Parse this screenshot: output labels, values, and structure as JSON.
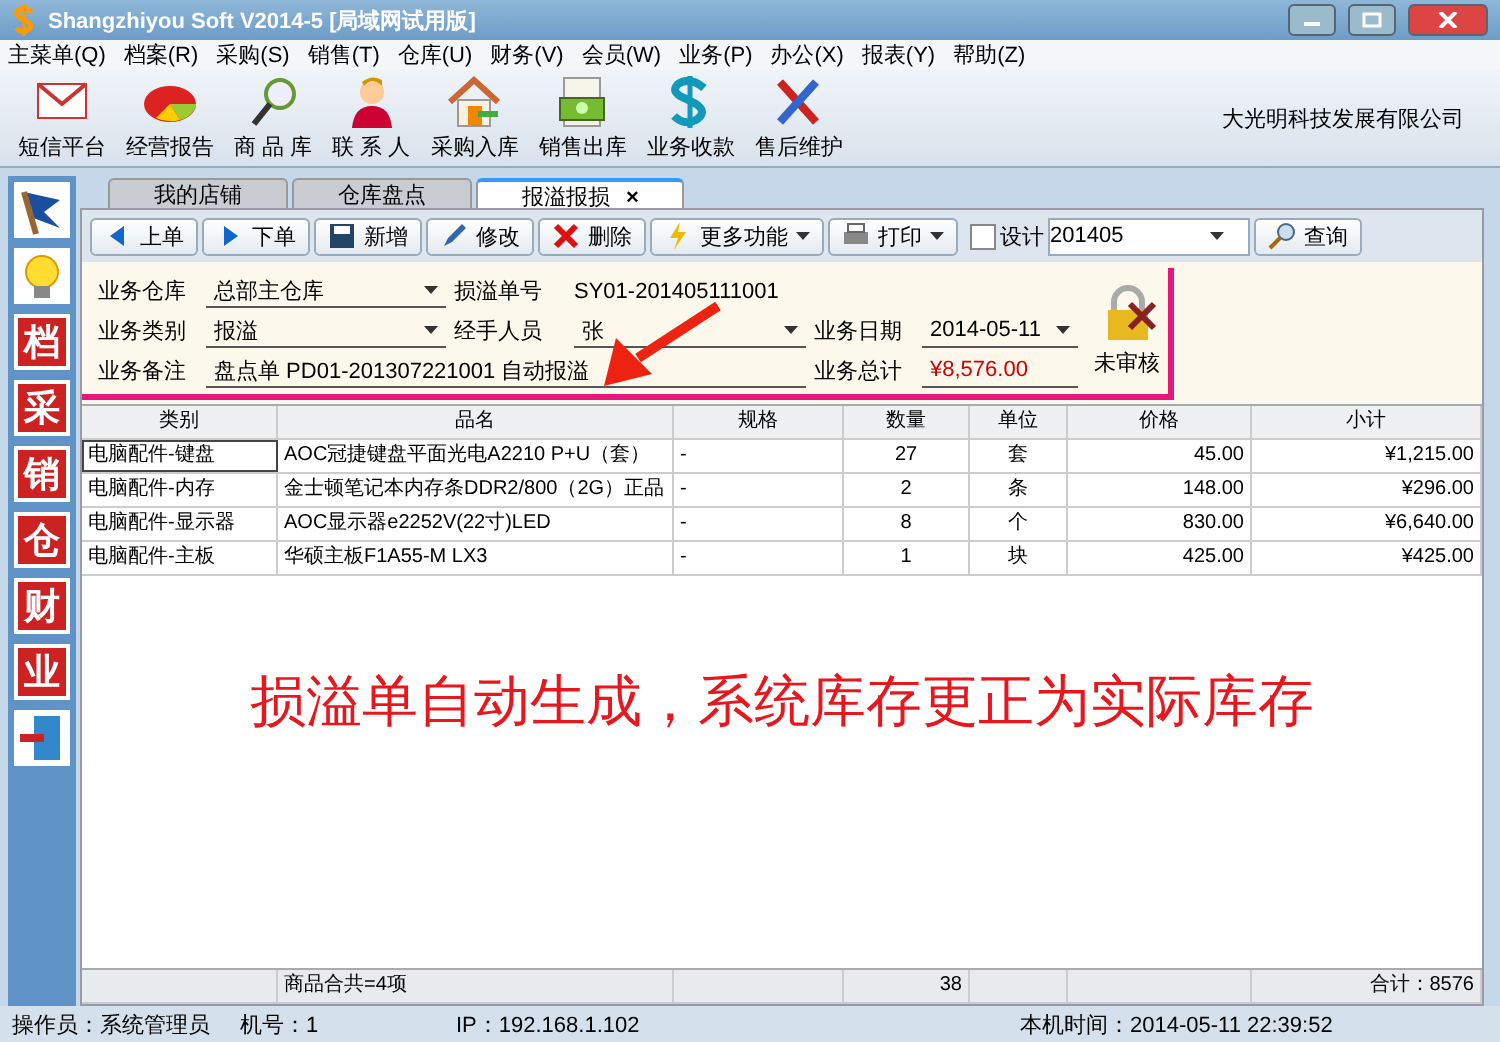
{
  "window": {
    "title": "Shangzhiyou Soft V2014-5 [局域网试用版]"
  },
  "menu": [
    "主菜单(Q)",
    "档案(R)",
    "采购(S)",
    "销售(T)",
    "仓库(U)",
    "财务(V)",
    "会员(W)",
    "业务(P)",
    "办公(X)",
    "报表(Y)",
    "帮助(Z)"
  ],
  "toolbar": [
    {
      "label": "短信平台",
      "kind": "mail"
    },
    {
      "label": "经营报告",
      "kind": "pie"
    },
    {
      "label": "商 品 库",
      "kind": "search"
    },
    {
      "label": "联 系 人",
      "kind": "person"
    },
    {
      "label": "采购入库",
      "kind": "house"
    },
    {
      "label": "销售出库",
      "kind": "money"
    },
    {
      "label": "业务收款",
      "kind": "dollar"
    },
    {
      "label": "售后维护",
      "kind": "tools"
    }
  ],
  "company": "大光明科技发展有限公司",
  "sidebar": [
    {
      "kind": "flag"
    },
    {
      "kind": "bulb"
    },
    {
      "kind": "glyph",
      "label": "档"
    },
    {
      "kind": "glyph",
      "label": "采"
    },
    {
      "kind": "glyph",
      "label": "销"
    },
    {
      "kind": "glyph",
      "label": "仓"
    },
    {
      "kind": "glyph",
      "label": "财"
    },
    {
      "kind": "glyph",
      "label": "业"
    },
    {
      "kind": "exit"
    }
  ],
  "tabs": [
    {
      "label": "我的店铺",
      "selected": false
    },
    {
      "label": "仓库盘点",
      "selected": false
    },
    {
      "label": "报溢报损",
      "selected": true,
      "close": "×"
    }
  ],
  "actions": [
    {
      "label": "上单",
      "kind": "prev"
    },
    {
      "label": "下单",
      "kind": "next"
    },
    {
      "label": "新增",
      "kind": "save"
    },
    {
      "label": "修改",
      "kind": "edit"
    },
    {
      "label": "删除",
      "kind": "delete"
    },
    {
      "label": "更多功能",
      "kind": "more"
    },
    {
      "label": "打印",
      "kind": "print"
    }
  ],
  "design": {
    "label": "设计",
    "checked": false
  },
  "period": {
    "value": "201405"
  },
  "query": "查询",
  "form": {
    "warehouse_label": "业务仓库",
    "warehouse": "总部主仓库",
    "number_label": "损溢单号",
    "number": "SY01-201405111001",
    "type_label": "业务类别",
    "type": "报溢",
    "handler_label": "经手人员",
    "handler": "张",
    "date_label": "业务日期",
    "date": "2014-05-11",
    "note_label": "业务备注",
    "note": "盘点单 PD01-201307221001 自动报溢",
    "total_label": "业务总计",
    "total": "¥8,576.00",
    "audit": "未审核"
  },
  "table": {
    "columns": [
      "类别",
      "品名",
      "规格",
      "数量",
      "单位",
      "价格",
      "小计"
    ],
    "rows": [
      [
        "电脑配件-键盘",
        "AOC冠捷键盘平面光电A2210 P+U（套）",
        "-",
        "27",
        "套",
        "45.00",
        "¥1,215.00"
      ],
      [
        "电脑配件-内存",
        "金士顿笔记本内存条DDR2/800（2G）正品",
        "-",
        "2",
        "条",
        "148.00",
        "¥296.00"
      ],
      [
        "电脑配件-显示器",
        "AOC显示器e2252V(22寸)LED",
        "-",
        "8",
        "个",
        "830.00",
        "¥6,640.00"
      ],
      [
        "电脑配件-主板",
        "华硕主板F1A55-M LX3",
        "-",
        "1",
        "块",
        "425.00",
        "¥425.00"
      ]
    ],
    "footer": {
      "count": "商品合共=4项",
      "quantity": "38",
      "total": "合计：8576"
    }
  },
  "caption": "损溢单自动生成，系统库存更正为实际库存",
  "status_bar": [
    "操作员：系统管理员",
    "机号：1",
    "IP：192.168.1.102",
    "本机时间：2014-05-11 22:39:52"
  ]
}
